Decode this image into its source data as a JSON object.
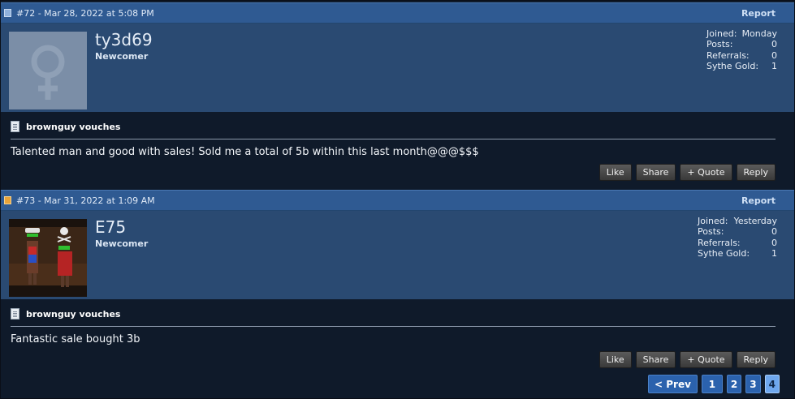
{
  "posts": [
    {
      "number_date": "#72 - Mar 28, 2022 at 5:08 PM",
      "report_label": "Report",
      "username": "ty3d69",
      "user_title": "Newcomer",
      "stats": [
        {
          "label": "Joined:",
          "value": "Monday"
        },
        {
          "label": "Posts:",
          "value": "0"
        },
        {
          "label": "Referrals:",
          "value": "0"
        },
        {
          "label": "Sythe Gold:",
          "value": "1"
        }
      ],
      "title": "brownguy vouches",
      "message": "Talented man and good with sales! Sold me a total of 5b within this last month@@@$$$",
      "buttons": {
        "like": "Like",
        "share": "Share",
        "quote": "+ Quote",
        "reply": "Reply"
      }
    },
    {
      "number_date": "#73 - Mar 31, 2022 at 1:09 AM",
      "report_label": "Report",
      "username": "E75",
      "user_title": "Newcomer",
      "stats": [
        {
          "label": "Joined:",
          "value": "Yesterday"
        },
        {
          "label": "Posts:",
          "value": "0"
        },
        {
          "label": "Referrals:",
          "value": "0"
        },
        {
          "label": "Sythe Gold:",
          "value": "1"
        }
      ],
      "title": "brownguy vouches",
      "message": "Fantastic sale bought 3b",
      "buttons": {
        "like": "Like",
        "share": "Share",
        "quote": "+ Quote",
        "reply": "Reply"
      }
    }
  ],
  "pagination": {
    "prev": "< Prev",
    "pages": [
      "1",
      "2",
      "3",
      "4"
    ],
    "current": "4"
  },
  "colors": {
    "header": "#2f5a92",
    "userbar": "#2a4a72",
    "body": "#0f1a2a",
    "pager_current": "#6ea7ee"
  }
}
